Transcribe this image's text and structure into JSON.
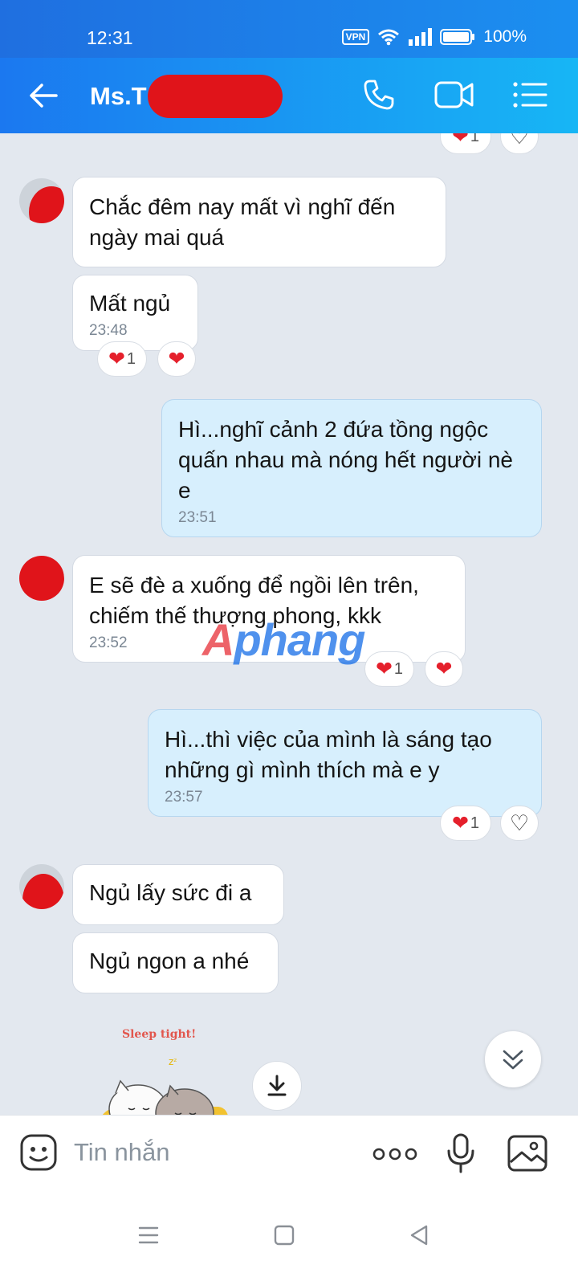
{
  "status_bar": {
    "time": "12:31",
    "vpn": "VPN",
    "battery": "100%"
  },
  "header": {
    "contact_name": "Ms.T"
  },
  "messages": [
    {
      "text": "Chắc đêm nay mất vì nghĩ đến ngày mai quá"
    },
    {
      "text": "Mất ngủ",
      "time": "23:48",
      "reaction_count": "1"
    },
    {
      "text": "Hì...nghĩ cảnh 2 đứa tồng ngộc quấn nhau mà nóng hết người nè e",
      "time": "23:51"
    },
    {
      "text": "E sẽ đè a xuống để ngồi lên trên, chiếm thế thượng phong, kkk",
      "time": "23:52",
      "reaction_count": "1"
    },
    {
      "text": "Hì...thì việc của mình là sáng tạo những gì mình thích mà e y",
      "time": "23:57",
      "reaction_count": "1"
    },
    {
      "text": "Ngủ lấy sức đi a"
    },
    {
      "text": "Ngủ ngon a nhé"
    }
  ],
  "top_partial_reaction_count": "1",
  "sticker": {
    "caption": "Sleep tight!"
  },
  "watermark": {
    "prefix": "A",
    "rest": "phang"
  },
  "composer": {
    "placeholder": "Tin nhắn"
  },
  "colors": {
    "accent": "#1b78f0",
    "my_bubble": "#d7effd",
    "heart": "#e5202c"
  }
}
